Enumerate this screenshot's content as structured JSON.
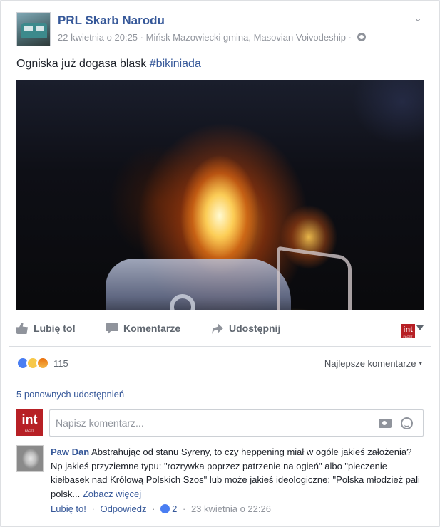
{
  "post": {
    "page_name": "PRL Skarb Narodu",
    "date": "22 kwietnia o 20:25",
    "separator": "·",
    "location": "Mińsk Mazowiecki gmina, Masovian Voivodeship",
    "text": "Ogniska już dogasa blask",
    "hashtag": "#bikiniada"
  },
  "actions": {
    "like": "Lubię to!",
    "comment": "Komentarze",
    "share": "Udostępnij"
  },
  "brand": {
    "logo_text": "int",
    "logo_subtext": "FACET",
    "color": "#b72025"
  },
  "reactions": {
    "count": "115",
    "types": [
      "like",
      "sad",
      "angry"
    ],
    "sort_label": "Najlepsze komentarze"
  },
  "shares_label": "5 ponownych udostępnień",
  "comment_input": {
    "placeholder": "Napisz komentarz..."
  },
  "comment": {
    "author": "Paw Dan",
    "text": "Abstrahując od stanu Syreny, to czy heppening miał w ogóle jakieś założenia? Np jakieś przyziemne typu: \"rozrywka poprzez patrzenie na ogień\" albo \"pieczenie kiełbasek nad Królową Polskich Szos\" lub może jakieś ideologiczne: \"Polska młodzież pali polsk...",
    "see_more": "Zobacz więcej",
    "like": "Lubię to!",
    "reply": "Odpowiedz",
    "like_count": "2",
    "timestamp": "23 kwietnia o 22:26"
  }
}
